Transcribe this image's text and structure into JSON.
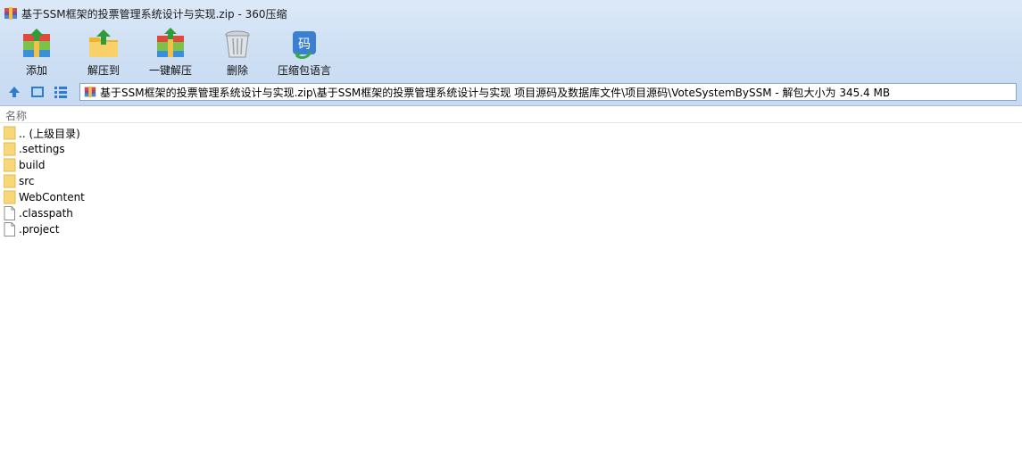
{
  "window": {
    "title": "基于SSM框架的投票管理系统设计与实现.zip - 360压缩"
  },
  "toolbar": {
    "buttons": [
      {
        "label": "添加",
        "icon": "add-archive-icon"
      },
      {
        "label": "解压到",
        "icon": "extract-to-icon"
      },
      {
        "label": "一键解压",
        "icon": "quick-extract-icon"
      },
      {
        "label": "删除",
        "icon": "trash-can-icon"
      },
      {
        "label": "压缩包语言",
        "icon": "archive-language-icon"
      }
    ]
  },
  "address": {
    "path": "基于SSM框架的投票管理系统设计与实现.zip\\基于SSM框架的投票管理系统设计与实现  项目源码及数据库文件\\项目源码\\VoteSystemBySSM - 解包大小为 345.4 MB"
  },
  "list": {
    "column_name": "名称",
    "items": [
      {
        "name": ".. (上级目录)",
        "type": "folder"
      },
      {
        "name": ".settings",
        "type": "folder"
      },
      {
        "name": "build",
        "type": "folder"
      },
      {
        "name": "src",
        "type": "folder"
      },
      {
        "name": "WebContent",
        "type": "folder"
      },
      {
        "name": ".classpath",
        "type": "file"
      },
      {
        "name": ".project",
        "type": "file"
      }
    ]
  },
  "colors": {
    "chrome_top": "#dce9f8",
    "chrome_bottom": "#c7daf1",
    "folder_fill": "#f7d77a",
    "accent_blue": "#3a78c8"
  }
}
